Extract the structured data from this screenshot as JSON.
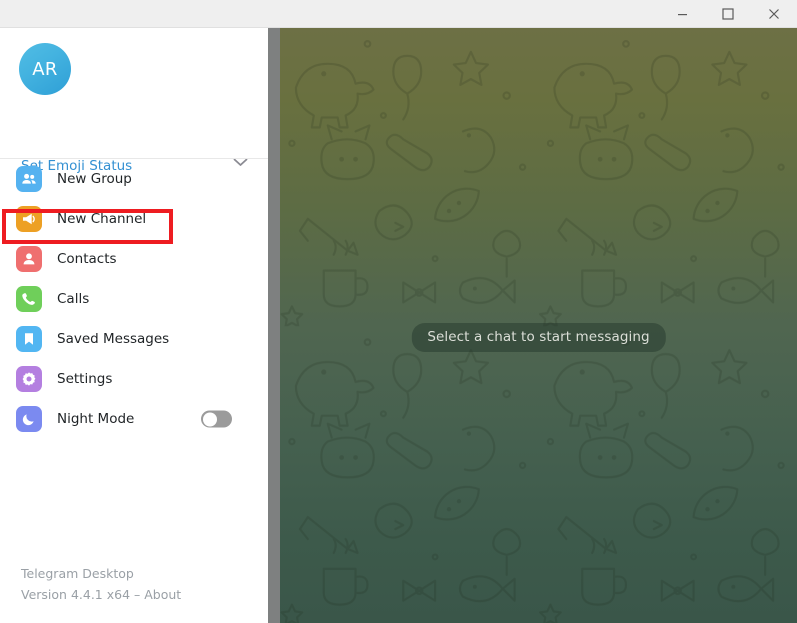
{
  "window": {
    "minimize_label": "Minimize",
    "maximize_label": "Maximize",
    "close_label": "Close"
  },
  "sidebar": {
    "avatar_initials": "AR",
    "emoji_status_label": "Set Emoji Status",
    "expand_icon": "chevron-down-icon",
    "menu_items": [
      {
        "label": "New Group",
        "icon": "new-group-icon",
        "color": "#55b2f0"
      },
      {
        "label": "New Channel",
        "icon": "new-channel-icon",
        "color": "#eda024"
      },
      {
        "label": "Contacts",
        "icon": "contacts-icon",
        "color": "#ef6f6f"
      },
      {
        "label": "Calls",
        "icon": "calls-icon",
        "color": "#6fcf5a"
      },
      {
        "label": "Saved Messages",
        "icon": "saved-messages-icon",
        "color": "#52b6f2"
      },
      {
        "label": "Settings",
        "icon": "settings-icon",
        "color": "#b47fe0"
      },
      {
        "label": "Night Mode",
        "icon": "night-mode-icon",
        "color": "#7b8af0"
      }
    ],
    "night_mode_enabled": false,
    "footer": {
      "app_name": "Telegram Desktop",
      "version_line": "Version 4.4.1 x64 – About"
    }
  },
  "chat": {
    "placeholder_text": "Select a chat to start messaging"
  },
  "annotation": {
    "highlight_target": "New Channel",
    "highlight_color": "#ee1c21"
  }
}
